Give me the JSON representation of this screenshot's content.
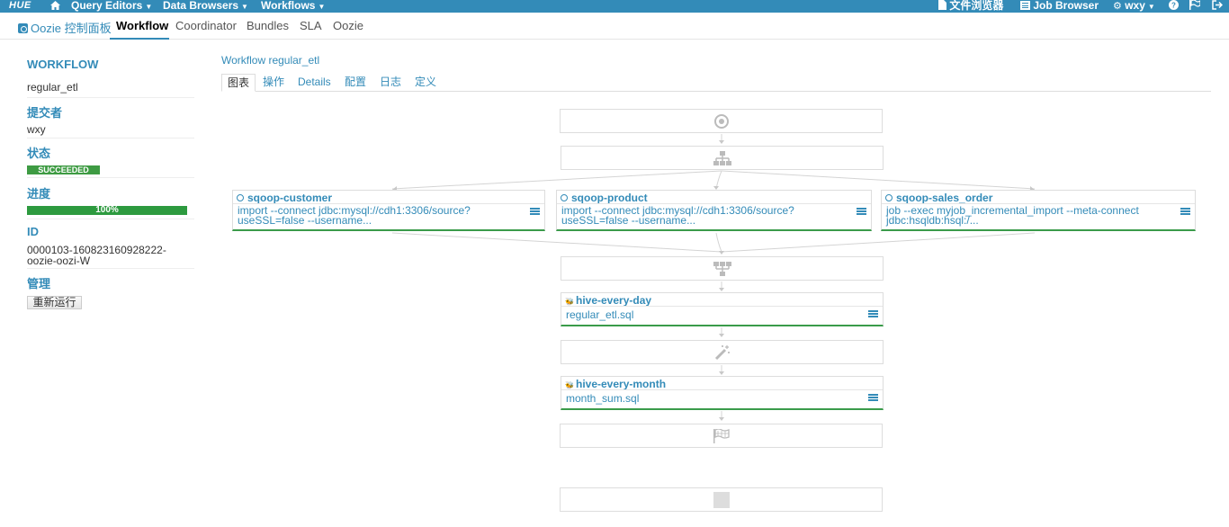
{
  "topbar": {
    "logo": "HUE",
    "query_editors": "Query Editors",
    "data_browsers": "Data Browsers",
    "workflows": "Workflows",
    "file_browser": "文件浏览器",
    "job_browser": "Job Browser",
    "user": "wxy"
  },
  "subnav": {
    "brand": "Oozie 控制面板",
    "items": [
      "Workflow",
      "Coordinator",
      "Bundles",
      "SLA",
      "Oozie"
    ]
  },
  "sidebar": {
    "workflow_label": "WORKFLOW",
    "workflow_value": "regular_etl",
    "submitter_label": "提交者",
    "submitter_value": "wxy",
    "status_label": "状态",
    "status_value": "SUCCEEDED",
    "progress_label": "进度",
    "progress_value": "100%",
    "progress_fraction": 1.0,
    "id_label": "ID",
    "id_value": "0000103-160823160928222-oozie-oozi-W",
    "manage_label": "管理",
    "rerun_button": "重新运行"
  },
  "main": {
    "breadcrumb": "Workflow regular_etl",
    "tabs": [
      "图表",
      "操作",
      "Details",
      "配置",
      "日志",
      "定义"
    ]
  },
  "graph": {
    "actions": [
      {
        "name": "sqoop-customer",
        "type": "sqoop",
        "command": "import --connect jdbc:mysql://cdh1:3306/source?useSSL=false --username..."
      },
      {
        "name": "sqoop-product",
        "type": "sqoop",
        "command": "import --connect jdbc:mysql://cdh1:3306/source?useSSL=false --username..."
      },
      {
        "name": "sqoop-sales_order",
        "type": "sqoop",
        "command": "job --exec myjob_incremental_import --meta-connect jdbc:hsqldb:hsql:/..."
      },
      {
        "name": "hive-every-day",
        "type": "hive",
        "command": "regular_etl.sql"
      },
      {
        "name": "hive-every-month",
        "type": "hive",
        "command": "month_sum.sql"
      }
    ],
    "control_icons": [
      "start-icon",
      "fork-icon",
      "join-icon",
      "decision-icon",
      "end-icon",
      "kill-icon"
    ]
  }
}
